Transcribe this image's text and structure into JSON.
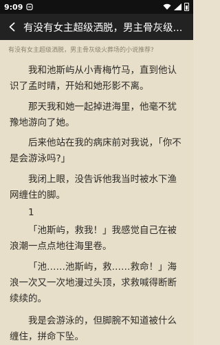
{
  "status_bar": {
    "time": "9:09",
    "icons": [
      "wifi-icon",
      "signal-icon",
      "battery-icon"
    ]
  },
  "header": {
    "back_icon": "chevron-left-icon",
    "title": "有没有女主超级洒脱，男主骨灰级..."
  },
  "content": {
    "subtitle": "有没有女主超级洒脱，男主骨灰级火葬场的小说推荐?",
    "paragraphs": [
      "我和池斯屿从小青梅竹马，直到他认识了孟时晴，开始和她形影不离。",
      "那天我和她一起掉进海里，他毫不犹豫地游向了她。",
      "后来他站在我的病床前对我说，「你不是会游泳吗?」",
      "我闭上眼，没告诉他我当时被水下渔网缠住的脚。",
      "1",
      "「池斯屿，救我！」我感觉自己在被浪潮一点点地往海里卷。",
      "「池……池斯屿，救……救命！」海浪一次又一次地漫过头顶，求救喊得断断续续的。",
      "我是会游泳的，但脚腕不知道被什么缠住，拼命下坠。"
    ]
  }
}
